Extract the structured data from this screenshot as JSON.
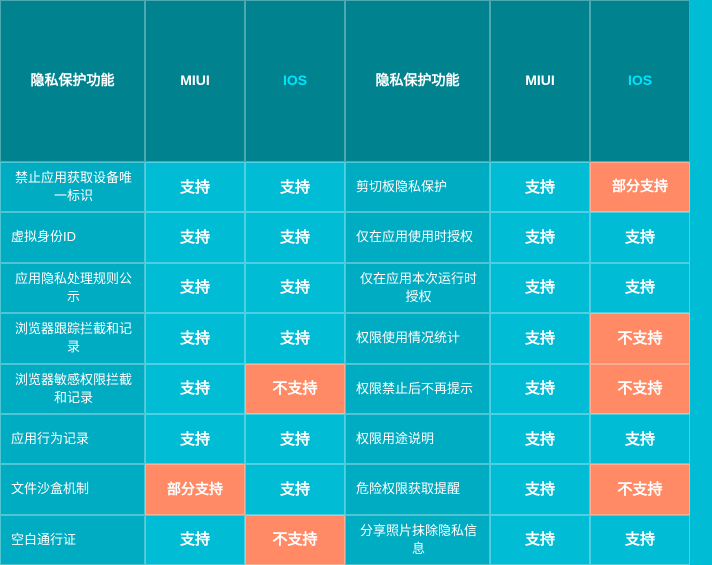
{
  "header": {
    "col1": "隐私保护功能",
    "col2": "MIUI",
    "col3": "IOS",
    "col4": "隐私保护功能",
    "col5": "MIUI",
    "col6": "IOS"
  },
  "rows": [
    {
      "feat1": "禁止应用获取设备唯一标识",
      "miui1": "支持",
      "ios1": "支持",
      "feat2": "剪切板隐私保护",
      "miui2": "支持",
      "ios2": "部分支持",
      "miui1_type": "support",
      "ios1_type": "support",
      "miui2_type": "support",
      "ios2_type": "partial"
    },
    {
      "feat1": "虚拟身份ID",
      "miui1": "支持",
      "ios1": "支持",
      "feat2": "仅在应用使用时授权",
      "miui2": "支持",
      "ios2": "支持",
      "miui1_type": "support",
      "ios1_type": "support",
      "miui2_type": "support",
      "ios2_type": "support"
    },
    {
      "feat1": "应用隐私处理规则公示",
      "miui1": "支持",
      "ios1": "支持",
      "feat2": "仅在应用本次运行时授权",
      "miui2": "支持",
      "ios2": "支持",
      "miui1_type": "support",
      "ios1_type": "support",
      "miui2_type": "support",
      "ios2_type": "support"
    },
    {
      "feat1": "浏览器跟踪拦截和记录",
      "miui1": "支持",
      "ios1": "支持",
      "feat2": "权限使用情况统计",
      "miui2": "支持",
      "ios2": "不支持",
      "miui1_type": "support",
      "ios1_type": "support",
      "miui2_type": "support",
      "ios2_type": "nosupport"
    },
    {
      "feat1": "浏览器敏感权限拦截和记录",
      "miui1": "支持",
      "ios1": "不支持",
      "feat2": "权限禁止后不再提示",
      "miui2": "支持",
      "ios2": "不支持",
      "miui1_type": "support",
      "ios1_type": "nosupport",
      "miui2_type": "support",
      "ios2_type": "nosupport"
    },
    {
      "feat1": "应用行为记录",
      "miui1": "支持",
      "ios1": "支持",
      "feat2": "权限用途说明",
      "miui2": "支持",
      "ios2": "支持",
      "miui1_type": "support",
      "ios1_type": "support",
      "miui2_type": "support",
      "ios2_type": "support"
    },
    {
      "feat1": "文件沙盒机制",
      "miui1": "部分支持",
      "ios1": "支持",
      "feat2": "危险权限获取提醒",
      "miui2": "支持",
      "ios2": "不支持",
      "miui1_type": "partial",
      "ios1_type": "support",
      "miui2_type": "support",
      "ios2_type": "nosupport"
    },
    {
      "feat1": "空白通行证",
      "miui1": "支持",
      "ios1": "不支持",
      "feat2": "分享照片抹除隐私信息",
      "miui2": "支持",
      "ios2": "支持",
      "miui1_type": "support",
      "ios1_type": "nosupport",
      "miui2_type": "support",
      "ios2_type": "support"
    }
  ]
}
